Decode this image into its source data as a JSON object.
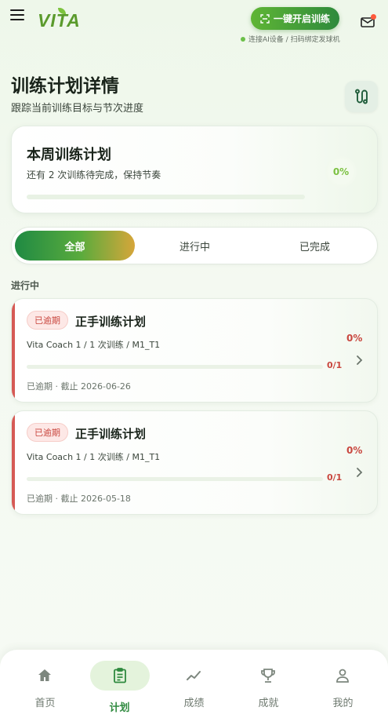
{
  "header": {
    "logo_text": "VITA",
    "start_button": "一键开启训练",
    "connect_hint": "连接AI设备 / 扫码绑定发球机"
  },
  "page": {
    "title": "训练计划详情",
    "subtitle": "跟踪当前训练目标与节次进度"
  },
  "week_card": {
    "title": "本周训练计划",
    "description": "还有 2 次训练待完成，保持节奏",
    "percent_label": "0%",
    "progress": 0
  },
  "tabs": [
    {
      "label": "全部",
      "active": true
    },
    {
      "label": "进行中",
      "active": false
    },
    {
      "label": "已完成",
      "active": false
    }
  ],
  "section_label": "进行中",
  "plans": [
    {
      "tag": "已逾期",
      "name": "正手训练计划",
      "coach_line": "Vita Coach 1 / 1 次训练 / M1_T1",
      "percent_label": "0%",
      "count": "0/1",
      "progress": 0,
      "deadline": "已逾期 · 截止 2026-06-26"
    },
    {
      "tag": "已逾期",
      "name": "正手训练计划",
      "coach_line": "Vita Coach 1 / 1 次训练 / M1_T1",
      "percent_label": "0%",
      "count": "0/1",
      "progress": 0,
      "deadline": "已逾期 · 截止 2026-05-18"
    }
  ],
  "nav": [
    {
      "label": "首页",
      "icon": "home-icon"
    },
    {
      "label": "计划",
      "icon": "clipboard-icon",
      "active": true
    },
    {
      "label": "成绩",
      "icon": "trend-chart-icon"
    },
    {
      "label": "成就",
      "icon": "trophy-icon"
    },
    {
      "label": "我的",
      "icon": "user-icon"
    }
  ],
  "colors": {
    "brand_green": "#2e8a3c",
    "accent_green": "#6cc04a",
    "overdue_red": "#d65a55"
  }
}
